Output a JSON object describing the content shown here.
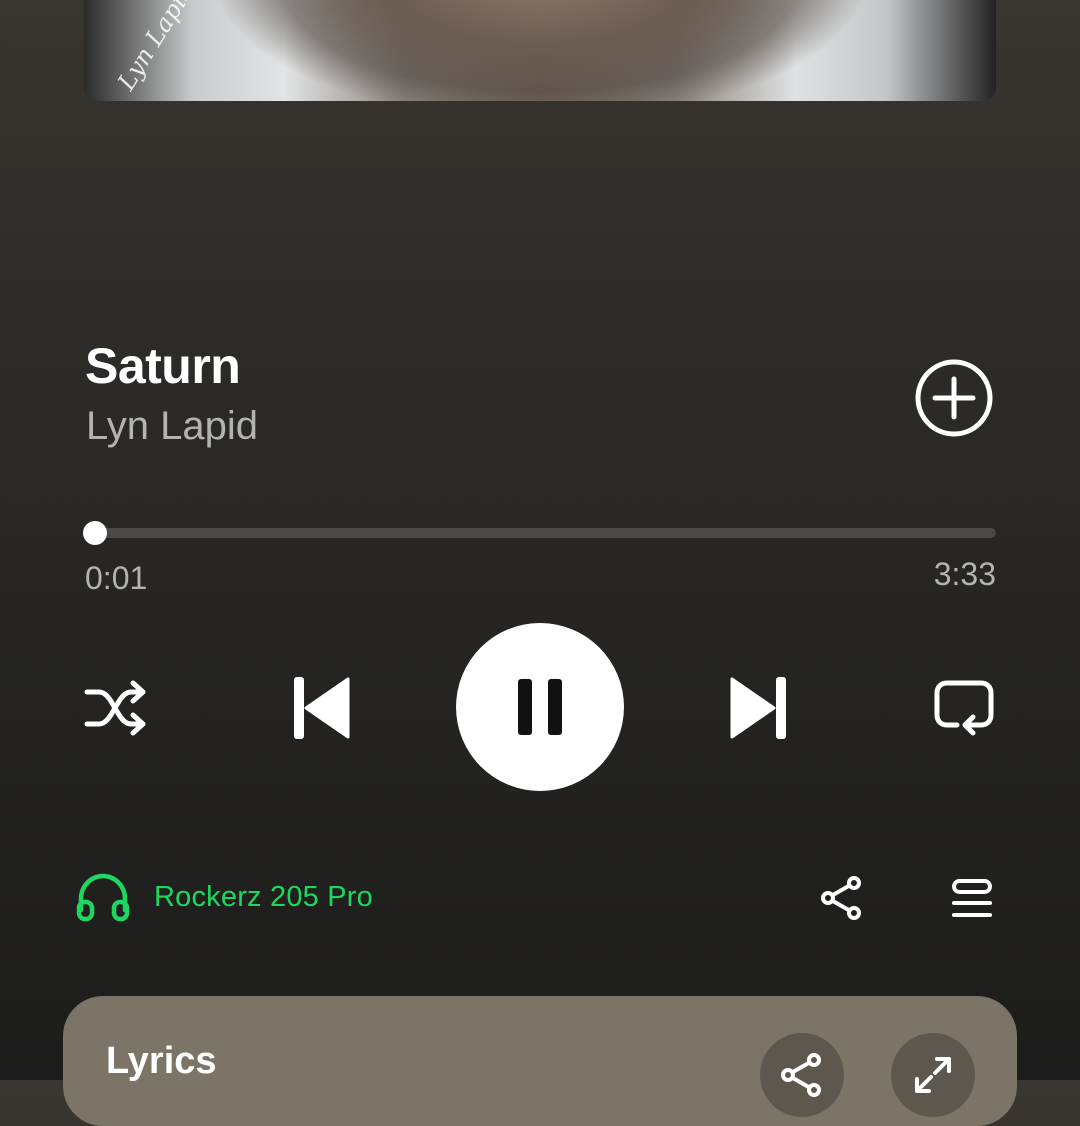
{
  "track": {
    "title": "Saturn",
    "artist": "Lyn Lapid",
    "art_signature": "Lyn Lapid"
  },
  "playback": {
    "elapsed": "0:01",
    "duration": "3:33",
    "progress_fraction": 0.005,
    "state": "playing"
  },
  "controls": {
    "shuffle_icon": "shuffle-icon",
    "previous_icon": "skip-previous-icon",
    "pause_icon": "pause-icon",
    "next_icon": "skip-next-icon",
    "repeat_icon": "repeat-icon",
    "add_icon": "add-circle-icon"
  },
  "device": {
    "name": "Rockerz 205 Pro",
    "icon": "headphones-icon",
    "color": "#1ed760"
  },
  "actions": {
    "share_icon": "share-icon",
    "queue_icon": "queue-icon"
  },
  "lyrics": {
    "title": "Lyrics",
    "share_icon": "share-icon",
    "expand_icon": "expand-icon",
    "card_color": "#7b7467"
  }
}
